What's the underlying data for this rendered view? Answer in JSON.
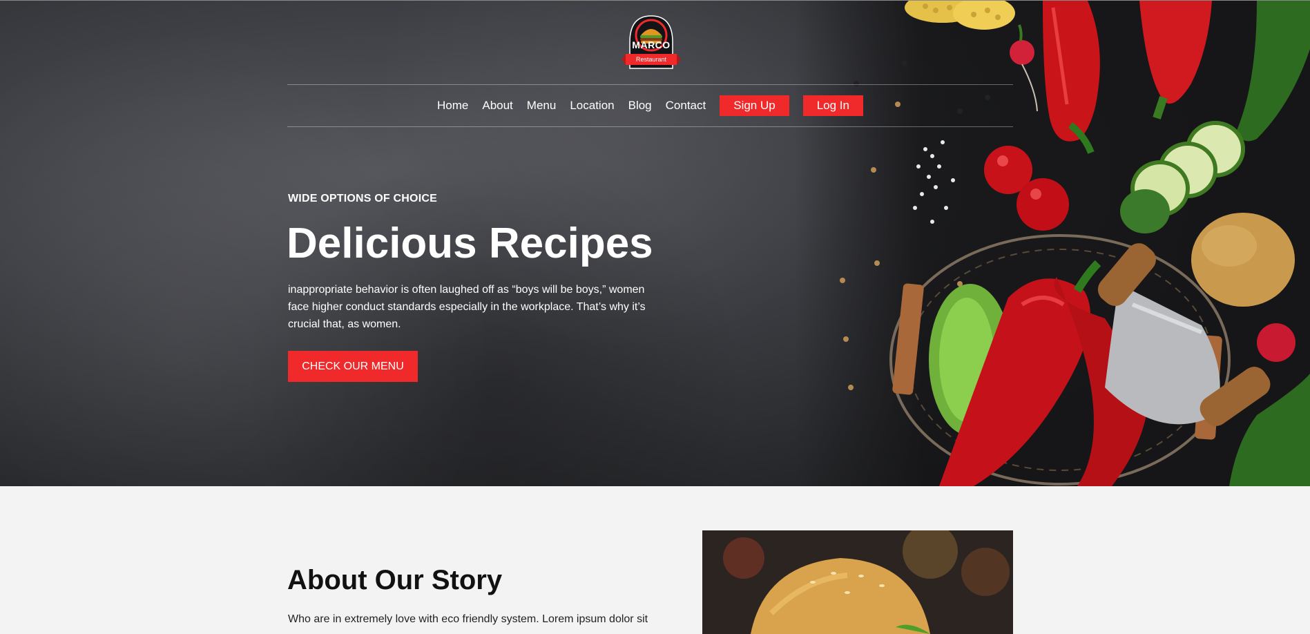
{
  "brand": {
    "name": "MARCO",
    "tagline": "Restaurant",
    "colors": {
      "accent": "#f02a2a",
      "dark": "#1c1c1e"
    }
  },
  "nav": {
    "items": [
      "Home",
      "About",
      "Menu",
      "Location",
      "Blog",
      "Contact"
    ],
    "signup": "Sign Up",
    "login": "Log In"
  },
  "hero": {
    "eyebrow": "WIDE OPTIONS OF CHOICE",
    "title": "Delicious Recipes",
    "body": "inappropriate behavior is often laughed off as “boys will be boys,” women face higher conduct standards especially in the workplace. That’s why it’s crucial that, as women.",
    "cta": "CHECK OUR MENU"
  },
  "about": {
    "title": "About Our Story",
    "body": "Who are in extremely love with eco friendly system. Lorem ipsum dolor sit"
  },
  "icons": [
    "burger-logo-icon",
    "vegetables-illustration",
    "burger-photo"
  ]
}
